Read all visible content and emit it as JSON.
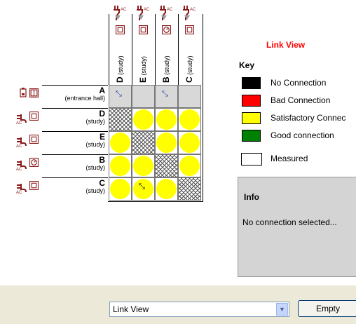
{
  "matrix": {
    "columns": [
      {
        "name": "D",
        "location": "(study)",
        "icon": "monitor-icon"
      },
      {
        "name": "E",
        "location": "(study)",
        "icon": "monitor-icon"
      },
      {
        "name": "B",
        "location": "(study)",
        "icon": "gauge-icon"
      },
      {
        "name": "C",
        "location": "(study)",
        "icon": "monitor-icon"
      }
    ],
    "rows": [
      {
        "name": "A",
        "location": "(entrance hall)",
        "icon": "door-icon",
        "cells": [
          "arrow",
          "empty",
          "arrow",
          "empty"
        ]
      },
      {
        "name": "D",
        "location": "(study)",
        "icon": "monitor-icon",
        "cells": [
          "self",
          "satisfactory",
          "satisfactory",
          "satisfactory"
        ]
      },
      {
        "name": "E",
        "location": "(study)",
        "icon": "monitor-icon",
        "cells": [
          "satisfactory",
          "self",
          "satisfactory",
          "satisfactory"
        ]
      },
      {
        "name": "B",
        "location": "(study)",
        "icon": "gauge-icon",
        "cells": [
          "satisfactory",
          "satisfactory",
          "self",
          "satisfactory"
        ]
      },
      {
        "name": "C",
        "location": "(study)",
        "icon": "monitor-icon",
        "cells": [
          "satisfactory",
          "arrow-satisfactory",
          "satisfactory",
          "self"
        ]
      }
    ],
    "arrow_glyph": "⤡"
  },
  "key": {
    "title": "Link View",
    "heading": "Key",
    "items": [
      {
        "label": "No Connection",
        "color": "#000000"
      },
      {
        "label": "Bad Connection",
        "color": "#ff0000"
      },
      {
        "label": "Satisfactory Connec",
        "color": "#ffff00"
      },
      {
        "label": "Good connection",
        "color": "#008000"
      },
      {
        "label": "Measured",
        "color": "#ffffff"
      }
    ]
  },
  "info": {
    "heading": "Info",
    "text": "No connection selected..."
  },
  "toolbar": {
    "view_select_value": "Link View",
    "dropdown_glyph": "▼",
    "empty_label": "Empty"
  }
}
